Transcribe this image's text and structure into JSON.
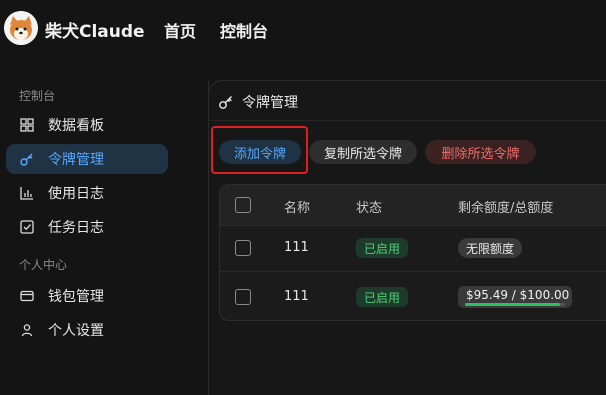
{
  "header": {
    "brand": "柴犬Claude",
    "nav": [
      "首页",
      "控制台"
    ]
  },
  "sidebar": {
    "groups": [
      {
        "title": "控制台",
        "items": [
          {
            "label": "数据看板",
            "icon": "dashboard-icon",
            "active": false
          },
          {
            "label": "令牌管理",
            "icon": "key-icon",
            "active": true
          },
          {
            "label": "使用日志",
            "icon": "bar-chart-icon",
            "active": false
          },
          {
            "label": "任务日志",
            "icon": "checkbox-task-icon",
            "active": false
          }
        ]
      },
      {
        "title": "个人中心",
        "items": [
          {
            "label": "钱包管理",
            "icon": "wallet-icon",
            "active": false
          },
          {
            "label": "个人设置",
            "icon": "user-icon",
            "active": false
          }
        ]
      }
    ]
  },
  "panel": {
    "title": "令牌管理",
    "buttons": {
      "add": "添加令牌",
      "copy": "复制所选令牌",
      "delete": "删除所选令牌"
    }
  },
  "table": {
    "headers": [
      "名称",
      "状态",
      "剩余额度/总额度"
    ],
    "rows": [
      {
        "name": "111",
        "status": "已启用",
        "quota": "无限额度",
        "quota_fraction": null
      },
      {
        "name": "111",
        "status": "已启用",
        "quota": "$95.49 / $100.00",
        "quota_fraction": 0.9549
      }
    ]
  },
  "colors": {
    "accent": "#55a8ff",
    "active_bg": "#1f3345",
    "enabled_green": "#4fd07a",
    "danger": "#f26b6b",
    "highlight_border": "#e02020"
  }
}
